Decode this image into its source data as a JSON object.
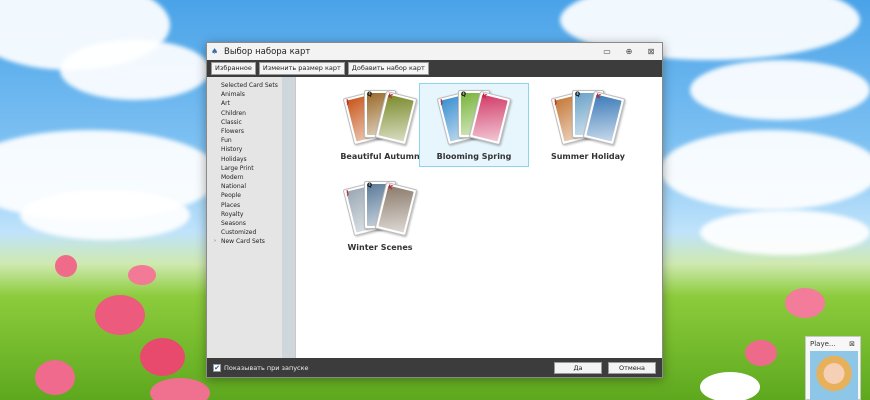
{
  "window": {
    "title": "Выбор набора карт"
  },
  "toolbar": {
    "favorites": "Избранное",
    "resize": "Изменить размер карт",
    "add_set": "Добавить набор карт"
  },
  "sidebar": {
    "items": [
      "Selected Card Sets",
      "Animals",
      "Art",
      "Children",
      "Classic",
      "Flowers",
      "Fun",
      "History",
      "Holidays",
      "Large Print",
      "Modern",
      "National",
      "People",
      "Places",
      "Royalty",
      "Seasons",
      "Customized"
    ],
    "new_card_sets": "New Card Sets"
  },
  "card_sets": [
    {
      "label": "Beautiful Autumn",
      "selected": false,
      "colors": [
        "#c8571c",
        "#9a6a2a",
        "#7a8a2a"
      ]
    },
    {
      "label": "Blooming Spring",
      "selected": true,
      "colors": [
        "#3c8fd0",
        "#78b43a",
        "#d23c6a"
      ]
    },
    {
      "label": "Summer Holiday",
      "selected": false,
      "colors": [
        "#c47a3a",
        "#6aa2c8",
        "#3c7ab8"
      ]
    },
    {
      "label": "Winter Scenes",
      "selected": false,
      "colors": [
        "#9aa8b4",
        "#5a7a98",
        "#8a7a6a"
      ]
    }
  ],
  "footer": {
    "show_on_start_label": "Показывать при запуске",
    "show_on_start_checked": "✔",
    "ok": "Да",
    "cancel": "Отмена"
  },
  "player": {
    "label": "Playe..."
  },
  "colors": {
    "accent": "#8fd4ee",
    "toolbar_bg": "#3c3c3c",
    "sidebar_bg": "#e5e5e5"
  }
}
